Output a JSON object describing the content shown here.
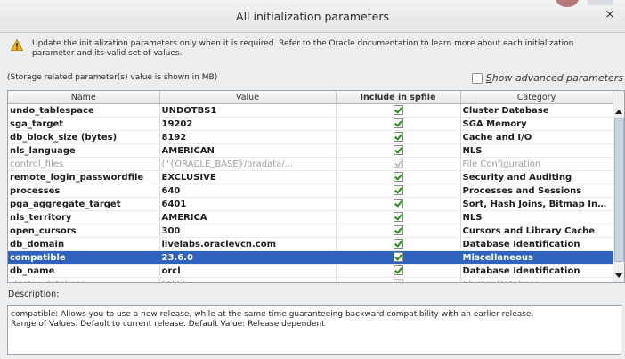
{
  "window": {
    "title": "All initialization parameters",
    "close_glyph": "×"
  },
  "warning": {
    "icon": "warning-triangle-icon",
    "text": "Update the initialization parameters only when it is required. Refer to the Oracle documentation to learn more about each initialization parameter and its valid set of values."
  },
  "storage_note": "(Storage related parameter(s) value is shown in MB)",
  "advanced": {
    "label_first": "S",
    "label_rest": "how advanced parameters",
    "checked": false
  },
  "table": {
    "headers": [
      "Name",
      "Value",
      "Include in spfile",
      "Category"
    ],
    "rows": [
      {
        "name": "undo_tablespace",
        "value": "UNDOTBS1",
        "include": true,
        "category": "Cluster Database",
        "state": "normal"
      },
      {
        "name": "sga_target",
        "value": "19202",
        "include": true,
        "category": "SGA Memory",
        "state": "normal"
      },
      {
        "name": "db_block_size (bytes)",
        "value": "8192",
        "include": true,
        "category": "Cache and I/O",
        "state": "normal"
      },
      {
        "name": "nls_language",
        "value": "AMERICAN",
        "include": true,
        "category": "NLS",
        "state": "normal"
      },
      {
        "name": "control_files",
        "value": "(\"{ORACLE_BASE}/oradata/...",
        "include": true,
        "category": "File Configuration",
        "state": "dim"
      },
      {
        "name": "remote_login_passwordfile",
        "value": "EXCLUSIVE",
        "include": true,
        "category": "Security and Auditing",
        "state": "normal"
      },
      {
        "name": "processes",
        "value": "640",
        "include": true,
        "category": "Processes and Sessions",
        "state": "normal"
      },
      {
        "name": "pga_aggregate_target",
        "value": "6401",
        "include": true,
        "category": "Sort, Hash Joins, Bitmap Indexes",
        "state": "normal"
      },
      {
        "name": "nls_territory",
        "value": "AMERICA",
        "include": true,
        "category": "NLS",
        "state": "normal"
      },
      {
        "name": "open_cursors",
        "value": "300",
        "include": true,
        "category": "Cursors and Library Cache",
        "state": "normal"
      },
      {
        "name": "db_domain",
        "value": "livelabs.oraclevcn.com",
        "include": true,
        "category": "Database Identification",
        "state": "normal"
      },
      {
        "name": "compatible",
        "value": "23.6.0",
        "include": true,
        "category": "Miscellaneous",
        "state": "selected"
      },
      {
        "name": "db_name",
        "value": "orcl",
        "include": true,
        "category": "Database Identification",
        "state": "normal"
      },
      {
        "name": "cluster_database",
        "value": "FALSE",
        "include": false,
        "category": "Cluster Database",
        "state": "dim"
      }
    ]
  },
  "description": {
    "label_first": "D",
    "label_rest": "escription:",
    "line1": "compatible: Allows you to use a new release, while at the same time guaranteeing backward compatibility with an earlier release.",
    "line2": "Range of Values: Default to current release. Default Value: Release dependent"
  },
  "colors": {
    "selection": "#2f63bd",
    "checkmark": "#2b8a1f"
  }
}
